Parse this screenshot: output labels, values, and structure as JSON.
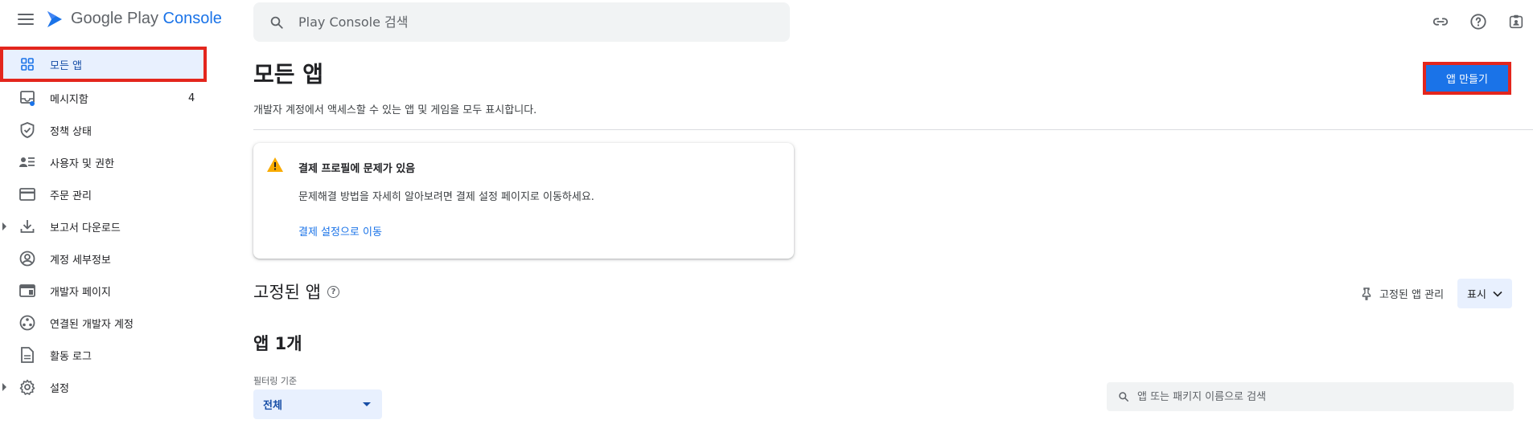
{
  "header": {
    "logo_text_main": "Google Play",
    "logo_text_accent": "Console",
    "search_placeholder": "Play Console 검색"
  },
  "sidebar": {
    "items": [
      {
        "label": "모든 앱",
        "icon": "grid-icon",
        "active": true
      },
      {
        "label": "메시지함",
        "icon": "inbox-icon",
        "count": "4"
      },
      {
        "label": "정책 상태",
        "icon": "shield-icon"
      },
      {
        "label": "사용자 및 권한",
        "icon": "users-icon"
      },
      {
        "label": "주문 관리",
        "icon": "credit-card-icon"
      },
      {
        "label": "보고서 다운로드",
        "icon": "download-icon",
        "expandable": true
      },
      {
        "label": "계정 세부정보",
        "icon": "account-icon"
      },
      {
        "label": "개발자 페이지",
        "icon": "web-page-icon"
      },
      {
        "label": "연결된 개발자 계정",
        "icon": "linked-accounts-icon"
      },
      {
        "label": "활동 로그",
        "icon": "document-icon"
      },
      {
        "label": "설정",
        "icon": "gear-icon",
        "expandable": true
      }
    ]
  },
  "main": {
    "title": "모든 앱",
    "subtitle": "개발자 계정에서 액세스할 수 있는 앱 및 게임을 모두 표시합니다.",
    "create_button": "앱 만들기",
    "warning": {
      "title": "결제 프로필에 문제가 있음",
      "body": "문제해결 방법을 자세히 알아보려면 결제 설정 페이지로 이동하세요.",
      "link": "결제 설정으로 이동"
    },
    "pinned": {
      "title": "고정된 앱",
      "help": "?",
      "manage_label": "고정된 앱 관리",
      "show_label": "표시"
    },
    "apps": {
      "count_title": "앱 1개",
      "filter_label": "필터링 기준",
      "filter_value": "전체",
      "search_placeholder": "앱 또는 패키지 이름으로 검색"
    }
  },
  "colors": {
    "accent": "#1a73e8",
    "highlight_border": "#e3261d",
    "warning": "#f9ab00"
  }
}
